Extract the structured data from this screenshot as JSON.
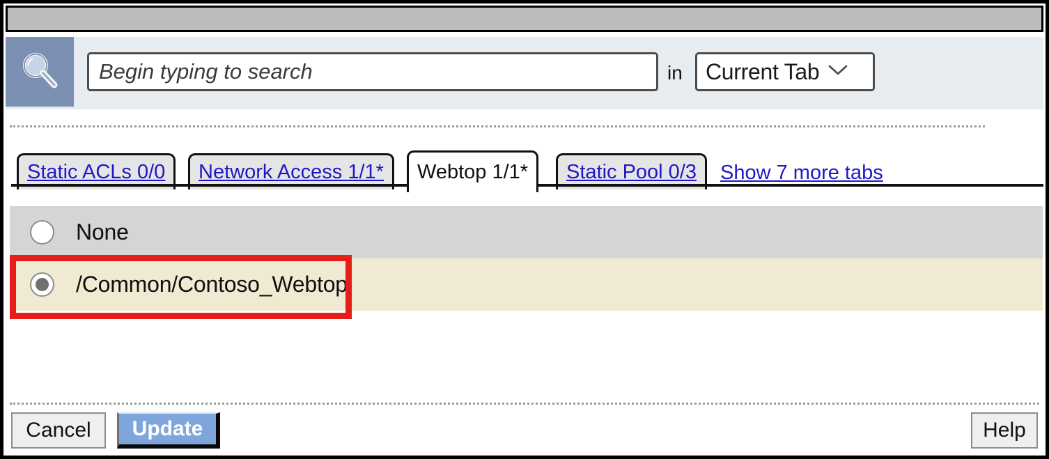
{
  "window": {
    "title_bar_text": ""
  },
  "search": {
    "icon": "search-magnifier-icon",
    "placeholder": "Begin typing to search",
    "value": "",
    "in_label": "in",
    "scope_selected": "Current Tab",
    "scope_chevron": "chevron-down-icon"
  },
  "tabs": {
    "items": [
      {
        "label": "Static ACLs 0/0",
        "active": false
      },
      {
        "label": "Network Access 1/1*",
        "active": false
      },
      {
        "label": "Webtop 1/1*",
        "active": true
      },
      {
        "label": "Static Pool 0/3",
        "active": false
      }
    ],
    "show_more_label": "Show 7 more tabs"
  },
  "options": {
    "rows": [
      {
        "label": "None",
        "selected": false
      },
      {
        "label": "/Common/Contoso_Webtop",
        "selected": true
      }
    ]
  },
  "annotation": {
    "color": "#e61d19",
    "target": "/Common/Contoso_Webtop"
  },
  "footer": {
    "cancel_label": "Cancel",
    "update_label": "Update",
    "help_label": "Help"
  },
  "colors": {
    "title_band": "#bcbcbc",
    "search_strip": "#e7ecf0",
    "search_icon_bg": "#7b90b2",
    "row_unselected": "#d5d5d7",
    "row_selected": "#f0ead2",
    "tab_inactive": "#e5e5e5",
    "tab_active": "#ffffff",
    "link": "#2116c7",
    "update_button": "#7fa6dc",
    "annotation_red": "#e61d19"
  }
}
